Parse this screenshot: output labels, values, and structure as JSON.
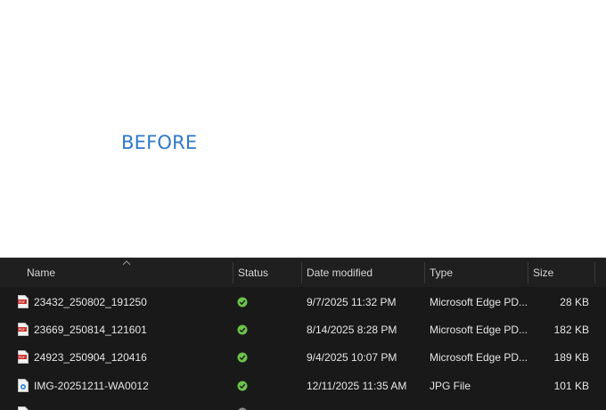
{
  "banner": {
    "text": "BEFORE"
  },
  "columns": {
    "name": "Name",
    "status": "Status",
    "date": "Date modified",
    "type": "Type",
    "size": "Size"
  },
  "files": [
    {
      "name": "23432_250802_191250",
      "date": "9/7/2025 11:32 PM",
      "type": "Microsoft Edge PD...",
      "size": "28 KB",
      "icon": "pdf-icon",
      "status": "synced-icon"
    },
    {
      "name": "23669_250814_121601",
      "date": "8/14/2025 8:28 PM",
      "type": "Microsoft Edge PD...",
      "size": "182 KB",
      "icon": "pdf-icon",
      "status": "synced-icon"
    },
    {
      "name": "24923_250904_120416",
      "date": "9/4/2025 10:07 PM",
      "type": "Microsoft Edge PD...",
      "size": "189 KB",
      "icon": "pdf-icon",
      "status": "synced-icon"
    },
    {
      "name": "IMG-20251211-WA0012",
      "date": "12/11/2025 11:35 AM",
      "type": "JPG File",
      "size": "101 KB",
      "icon": "image-file-icon",
      "status": "synced-icon"
    }
  ],
  "colors": {
    "accent_text": "#2f78c8",
    "pdf_red": "#c9302c",
    "status_green": "#6cc24a",
    "background_dark": "#191919"
  }
}
